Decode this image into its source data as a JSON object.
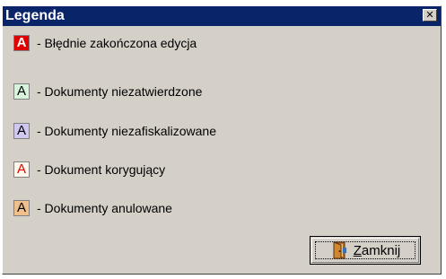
{
  "window": {
    "title": "Legenda",
    "close_glyph": "✕"
  },
  "legend": [
    {
      "sample": "A",
      "text": "- Błędnie zakończona edycja",
      "bg": "#e00000",
      "fg": "#ffffff",
      "bold": true
    },
    {
      "sample": "A",
      "text": "- Dokumenty niezatwierdzone",
      "bg": "#d8f4dc",
      "fg": "#000000",
      "bold": false
    },
    {
      "sample": "A",
      "text": "- Dokumenty niezafiskalizowane",
      "bg": "#d0c8f0",
      "fg": "#000000",
      "bold": false
    },
    {
      "sample": "A",
      "text": "- Dokument korygujący",
      "bg": "#fff8ec",
      "fg": "#e00000",
      "bold": false
    },
    {
      "sample": "A",
      "text": "- Dokumenty anulowane",
      "bg": "#f0c08c",
      "fg": "#000000",
      "bold": false
    }
  ],
  "buttons": {
    "close_mnemonic": "Z",
    "close_rest": "amknij",
    "close_icon": "door-icon"
  }
}
